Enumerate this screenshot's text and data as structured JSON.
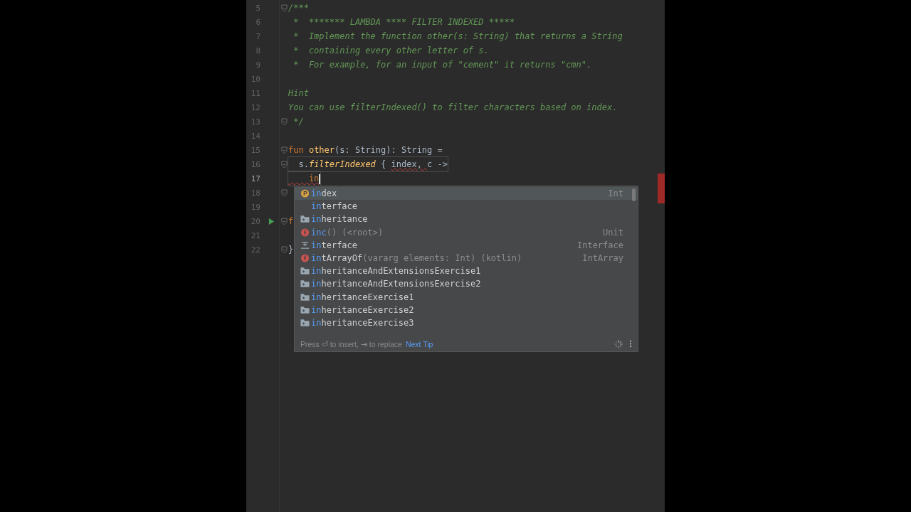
{
  "editor": {
    "lines": [
      {
        "number": "5",
        "fold": true,
        "segments": [
          {
            "kind": "comment",
            "text": "/***"
          }
        ]
      },
      {
        "number": "6",
        "segments": [
          {
            "kind": "comment",
            "text": " *  ******* LAMBDA **** FILTER INDEXED *****"
          }
        ]
      },
      {
        "number": "7",
        "segments": [
          {
            "kind": "comment",
            "text": " *  Implement the function other(s: String) that returns a String"
          }
        ]
      },
      {
        "number": "8",
        "segments": [
          {
            "kind": "comment",
            "text": " *  containing every other letter of s."
          }
        ]
      },
      {
        "number": "9",
        "segments": [
          {
            "kind": "comment",
            "text": " *  For example, for an input of \"cement\" it returns \"cmn\"."
          }
        ]
      },
      {
        "number": "10"
      },
      {
        "number": "11",
        "segments": [
          {
            "kind": "comment",
            "text": "Hint"
          }
        ]
      },
      {
        "number": "12",
        "segments": [
          {
            "kind": "comment",
            "text": "You can use filterIndexed() to filter characters based on index."
          }
        ]
      },
      {
        "number": "13",
        "fold": true,
        "segments": [
          {
            "kind": "comment",
            "text": " */"
          }
        ]
      },
      {
        "number": "14"
      },
      {
        "number": "15",
        "fold": true,
        "segments": [
          {
            "kind": "keyword",
            "text": "fun "
          },
          {
            "kind": "function",
            "text": "other"
          },
          {
            "kind": "plain",
            "text": "(s: String): String ="
          }
        ]
      },
      {
        "number": "16",
        "fold": true,
        "segments": [
          {
            "kind": "plain",
            "text": "  s."
          },
          {
            "kind": "call",
            "text": "filterIndexed"
          },
          {
            "kind": "plain",
            "text": " { "
          },
          {
            "kind": "warning",
            "text": "index, "
          },
          {
            "kind": "plain",
            "text": "c ->"
          }
        ]
      },
      {
        "number": "17",
        "current": true,
        "segments": [
          {
            "kind": "error",
            "text": "    in"
          }
        ]
      },
      {
        "number": "18",
        "fold": true
      },
      {
        "number": "19"
      },
      {
        "number": "20",
        "fold": true,
        "run": true,
        "segments": [
          {
            "kind": "keyword",
            "text": "f"
          }
        ]
      },
      {
        "number": "21"
      },
      {
        "number": "22",
        "fold": true,
        "segments": [
          {
            "kind": "plain",
            "text": "}"
          }
        ]
      }
    ]
  },
  "completion": {
    "items": [
      {
        "kind": "parameter",
        "match": "in",
        "rest": "dex",
        "type": "Int",
        "selected": true
      },
      {
        "kind": "keyword",
        "match": "in",
        "rest": "terface",
        "selected": false
      },
      {
        "kind": "package",
        "match": "in",
        "rest": "heritance",
        "selected": false
      },
      {
        "kind": "function",
        "match": "inc",
        "tail": "() (<root>)",
        "type": "Unit",
        "selected": false
      },
      {
        "kind": "template",
        "match": "in",
        "rest": "terface",
        "type": "Interface",
        "selected": false
      },
      {
        "kind": "function",
        "match": "in",
        "rest": "tArrayOf",
        "tail": "(vararg elements: Int) (kotlin)",
        "type": "IntArray",
        "selected": false
      },
      {
        "kind": "package",
        "match": "in",
        "rest": "heritanceAndExtensionsExercise1",
        "selected": false
      },
      {
        "kind": "package",
        "match": "in",
        "rest": "heritanceAndExtensionsExercise2",
        "selected": false
      },
      {
        "kind": "package",
        "match": "in",
        "rest": "heritanceExercise1",
        "selected": false
      },
      {
        "kind": "package",
        "match": "in",
        "rest": "heritanceExercise2",
        "selected": false
      },
      {
        "kind": "package",
        "match": "in",
        "rest": "heritanceExercise3",
        "selected": false
      }
    ],
    "hint": "Press ⏎ to insert, ⇥ to replace",
    "tip_link": "Next Tip"
  }
}
